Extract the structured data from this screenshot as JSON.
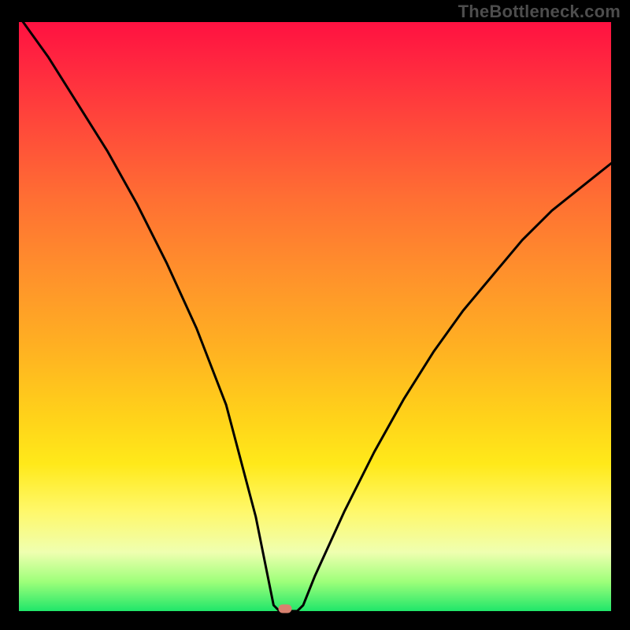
{
  "watermark": "TheBottleneck.com",
  "chart_data": {
    "type": "line",
    "title": "",
    "xlabel": "",
    "ylabel": "",
    "xlim": [
      0,
      100
    ],
    "ylim": [
      0,
      100
    ],
    "grid": false,
    "series": [
      {
        "name": "bottleneck-curve",
        "x": [
          0,
          5,
          10,
          15,
          20,
          25,
          30,
          35,
          40,
          43,
          44,
          45,
          46,
          47,
          48,
          50,
          55,
          60,
          65,
          70,
          75,
          80,
          85,
          90,
          95,
          100
        ],
        "y": [
          101,
          94,
          86,
          78,
          69,
          59,
          48,
          35,
          16,
          1,
          0,
          0,
          0,
          0,
          1,
          6,
          17,
          27,
          36,
          44,
          51,
          57,
          63,
          68,
          72,
          76
        ]
      }
    ],
    "marker": {
      "x": 45,
      "y": 0.4,
      "color": "#d8816f",
      "shape": "pill"
    },
    "background_gradient": {
      "direction": "vertical",
      "stops": [
        {
          "pos": 0.0,
          "color": "#ff1141"
        },
        {
          "pos": 0.3,
          "color": "#ff6f33"
        },
        {
          "pos": 0.55,
          "color": "#ffb022"
        },
        {
          "pos": 0.75,
          "color": "#ffe91a"
        },
        {
          "pos": 0.9,
          "color": "#efffb0"
        },
        {
          "pos": 1.0,
          "color": "#20e66a"
        }
      ]
    }
  }
}
